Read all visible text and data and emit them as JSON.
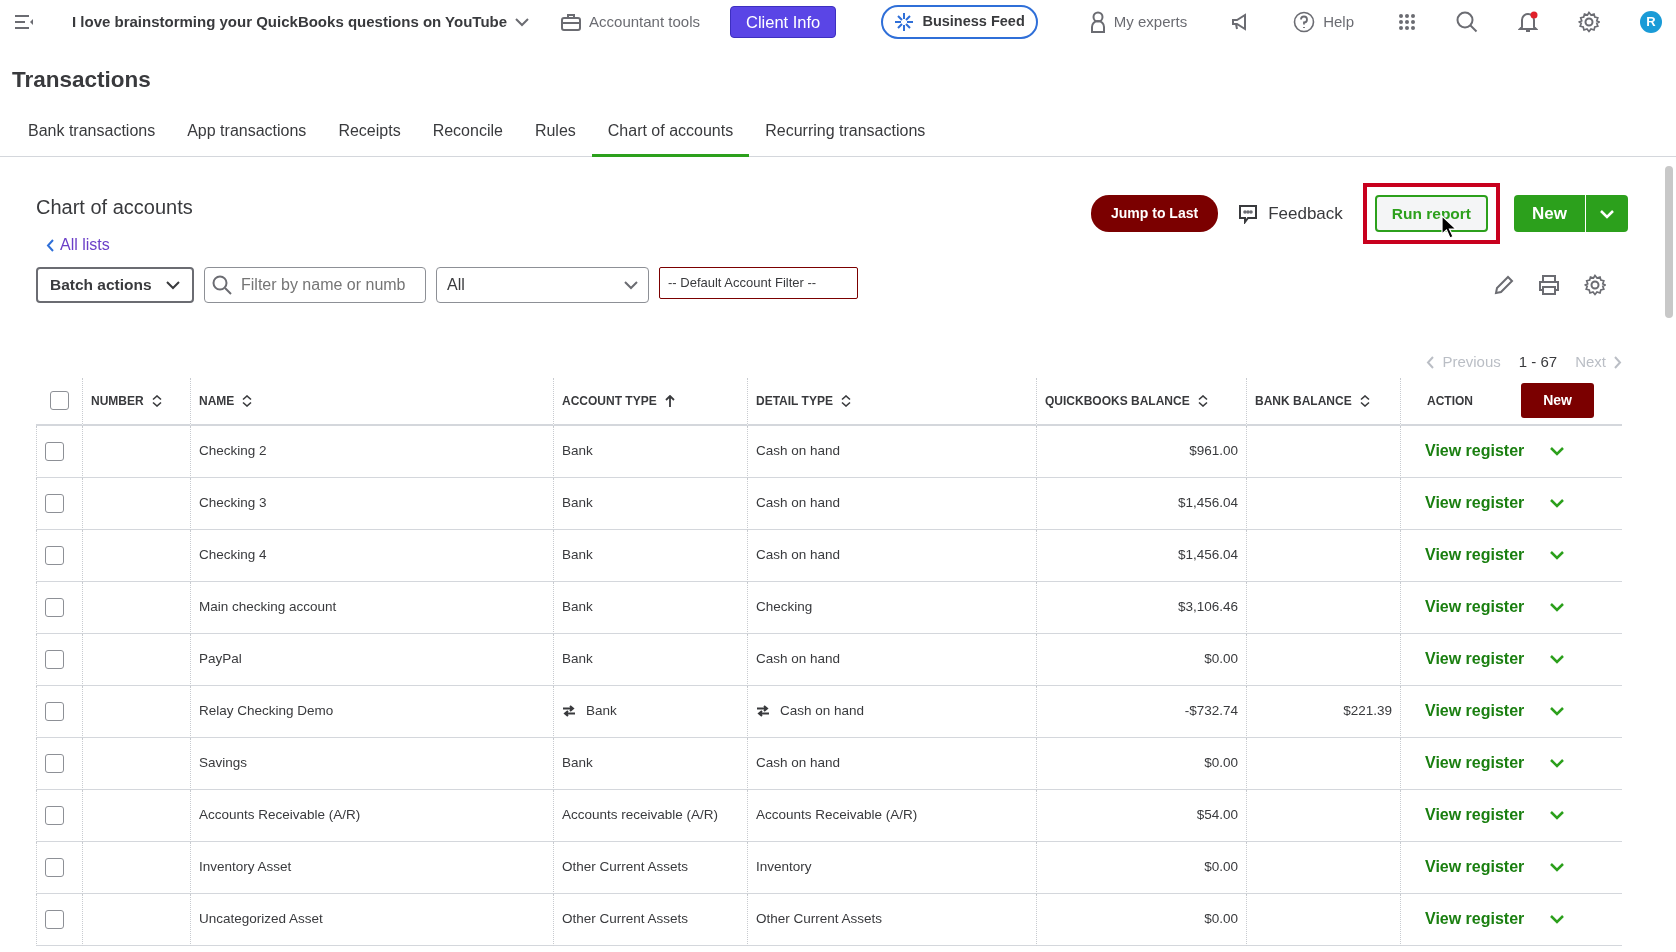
{
  "topbar": {
    "company": "I love brainstorming your QuickBooks questions on YouTube",
    "accountant_tools": "Accountant tools",
    "client_info": "Client Info",
    "business_feed": "Business Feed",
    "my_experts": "My experts",
    "help": "Help",
    "avatar": "R",
    "notification": true
  },
  "page_title": "Transactions",
  "tabs": [
    {
      "label": "Bank transactions",
      "selected": false
    },
    {
      "label": "App transactions",
      "selected": false
    },
    {
      "label": "Receipts",
      "selected": false
    },
    {
      "label": "Reconcile",
      "selected": false
    },
    {
      "label": "Rules",
      "selected": false
    },
    {
      "label": "Chart of accounts",
      "selected": true
    },
    {
      "label": "Recurring transactions",
      "selected": false
    }
  ],
  "section_title": "Chart of accounts",
  "back_link": "All lists",
  "actions": {
    "jump": "Jump to Last",
    "feedback": "Feedback",
    "run_report": "Run report",
    "run_report_highlighted": true,
    "new": "New"
  },
  "filters": {
    "batch": "Batch actions",
    "search_placeholder": "Filter by name or numb",
    "type_value": "All",
    "default_filter": "-- Default Account Filter --"
  },
  "pagination": {
    "previous": "Previous",
    "range": "1 - 67",
    "next": "Next"
  },
  "table": {
    "select_all_checked": false,
    "columns": [
      {
        "label": "NUMBER",
        "sortable": true,
        "sorted": false
      },
      {
        "label": "NAME",
        "sortable": true,
        "sorted": false
      },
      {
        "label": "ACCOUNT TYPE",
        "sortable": true,
        "sorted": true
      },
      {
        "label": "DETAIL TYPE",
        "sortable": true,
        "sorted": false
      },
      {
        "label": "QUICKBOOKS BALANCE",
        "sortable": true,
        "sorted": false
      },
      {
        "label": "BANK BALANCE",
        "sortable": true,
        "sorted": false
      },
      {
        "label": "ACTION",
        "sortable": false,
        "sorted": false
      }
    ],
    "new_button": "New",
    "rows": [
      {
        "checked": false,
        "name": "Checking 2",
        "account_type": "Bank",
        "detail_type": "Cash on hand",
        "qb_balance": "$961.00",
        "synced": false,
        "action": "View register"
      },
      {
        "checked": false,
        "name": "Checking 3",
        "account_type": "Bank",
        "detail_type": "Cash on hand",
        "qb_balance": "$1,456.04",
        "synced": false,
        "action": "View register"
      },
      {
        "checked": false,
        "name": "Checking 4",
        "account_type": "Bank",
        "detail_type": "Cash on hand",
        "qb_balance": "$1,456.04",
        "synced": false,
        "action": "View register"
      },
      {
        "checked": false,
        "name": "Main checking account",
        "account_type": "Bank",
        "detail_type": "Checking",
        "qb_balance": "$3,106.46",
        "synced": false,
        "action": "View register"
      },
      {
        "checked": false,
        "name": "PayPal",
        "account_type": "Bank",
        "detail_type": "Cash on hand",
        "qb_balance": "$0.00",
        "synced": false,
        "action": "View register"
      },
      {
        "checked": false,
        "name": "Relay Checking Demo",
        "account_type": "Bank",
        "detail_type": "Cash on hand",
        "qb_balance": "-$732.74",
        "bank_balance": "$221.39",
        "synced": true,
        "action": "View register"
      },
      {
        "checked": false,
        "name": "Savings",
        "account_type": "Bank",
        "detail_type": "Cash on hand",
        "qb_balance": "$0.00",
        "synced": false,
        "action": "View register"
      },
      {
        "checked": false,
        "name": "Accounts Receivable (A/R)",
        "account_type": "Accounts receivable (A/R)",
        "detail_type": "Accounts Receivable (A/R)",
        "qb_balance": "$54.00",
        "synced": false,
        "action": "View register"
      },
      {
        "checked": false,
        "name": "Inventory Asset",
        "account_type": "Other Current Assets",
        "detail_type": "Inventory",
        "qb_balance": "$0.00",
        "synced": false,
        "action": "View register"
      },
      {
        "checked": false,
        "name": "Uncategorized Asset",
        "account_type": "Other Current Assets",
        "detail_type": "Other Current Assets",
        "qb_balance": "$0.00",
        "synced": false,
        "action": "View register"
      }
    ]
  }
}
